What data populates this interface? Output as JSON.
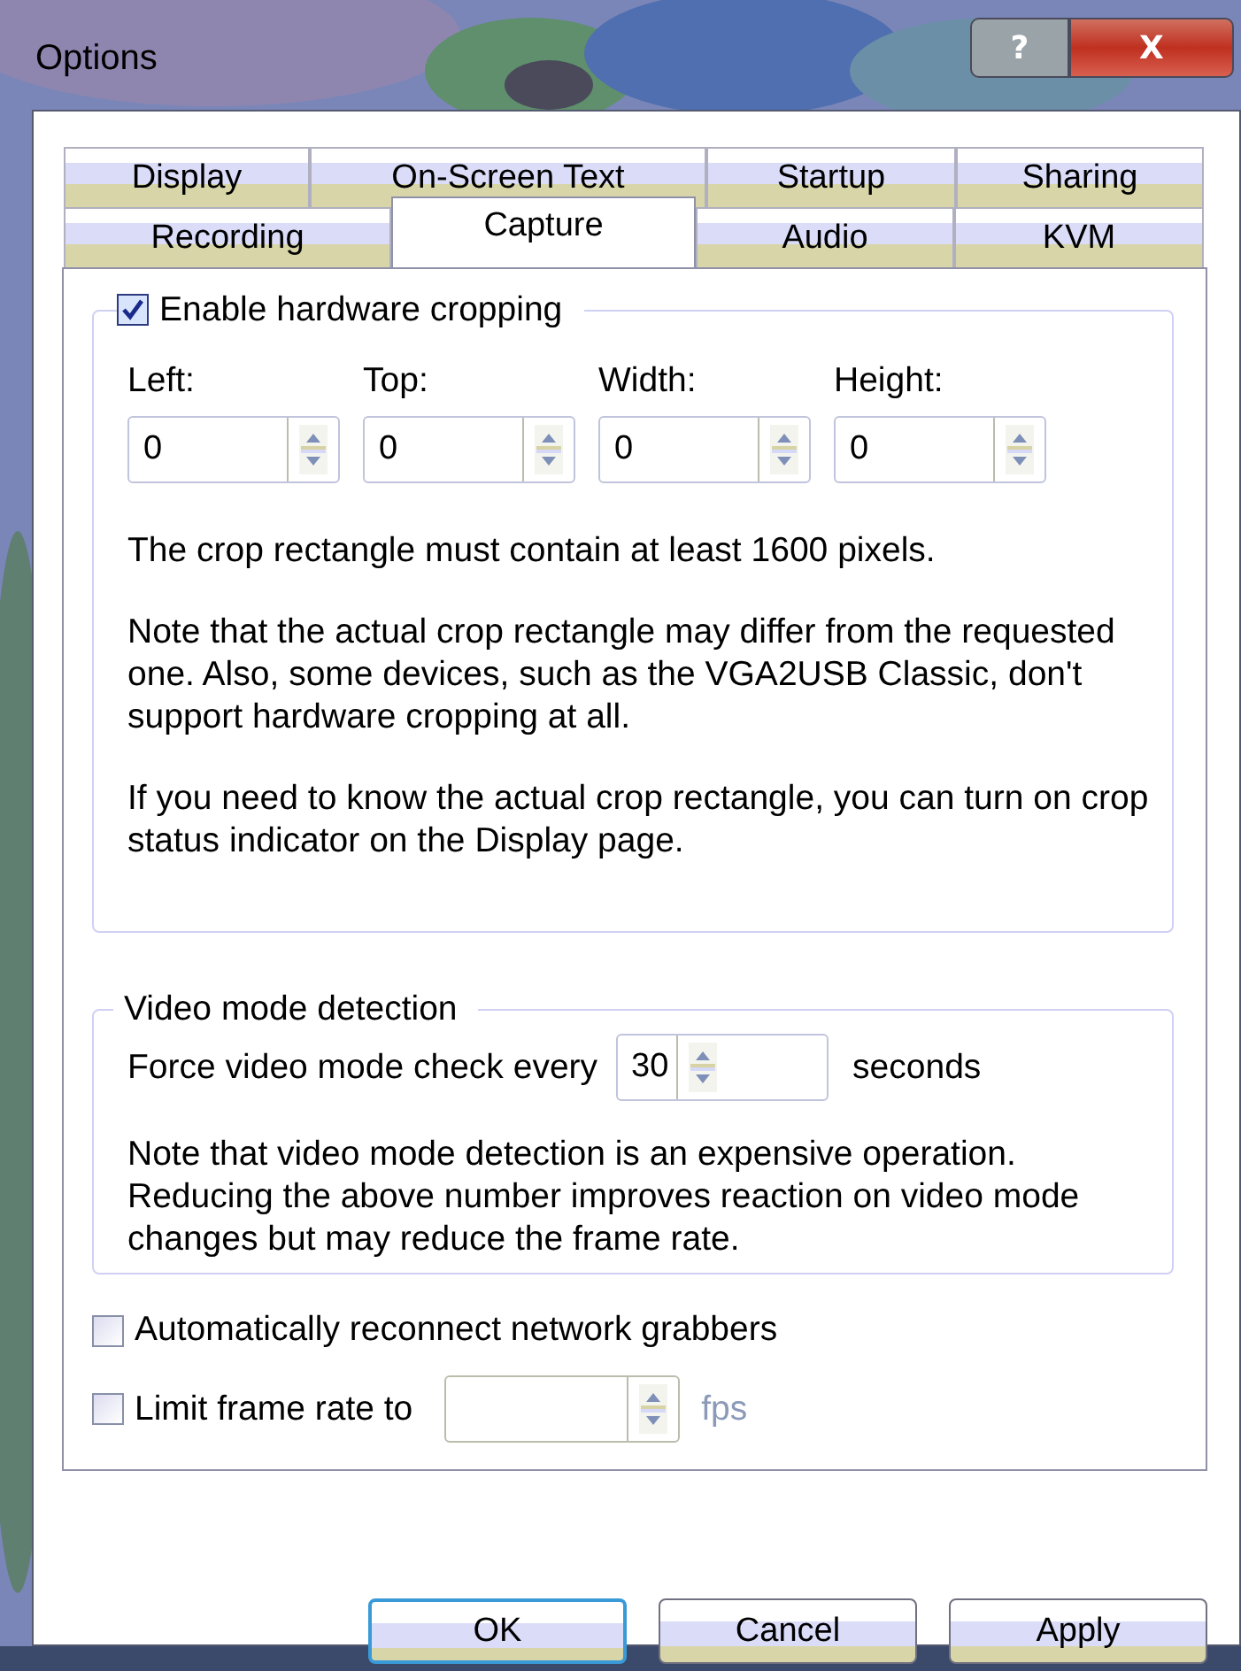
{
  "window": {
    "title": "Options",
    "buttons": [
      {
        "kind": "help",
        "label": "?"
      },
      {
        "kind": "close",
        "label": "X"
      }
    ]
  },
  "tab_rows": [
    [
      {
        "label": "Display",
        "selected": false
      },
      {
        "label": "On-Screen Text",
        "selected": false
      },
      {
        "label": "Startup",
        "selected": false
      },
      {
        "label": "Sharing",
        "selected": false
      }
    ],
    [
      {
        "label": "Recording",
        "selected": false
      },
      {
        "label": "Capture",
        "selected": true
      },
      {
        "label": "Audio",
        "selected": false
      },
      {
        "label": "KVM",
        "selected": false
      }
    ]
  ],
  "cropping": {
    "label": "Enable hardware cropping",
    "checked": true,
    "fields": [
      {
        "label": "Left:",
        "value": "0"
      },
      {
        "label": "Top:",
        "value": "0"
      },
      {
        "label": "Width:",
        "value": "0"
      },
      {
        "label": "Height:",
        "value": "0"
      }
    ],
    "notes": [
      "The crop rectangle must contain at least 1600 pixels.",
      "Note that the actual crop rectangle may differ from the requested one. Also, some devices, such as the VGA2USB Classic, don't support hardware cropping at all.",
      "If you need to know the actual crop rectangle, you can turn on crop status indicator on the Display page."
    ]
  },
  "video_mode": {
    "title": "Video mode detection",
    "prefix": "Force video mode check every",
    "value": "30",
    "suffix": "seconds",
    "note": "Note that video mode detection is an expensive operation. Reducing the above number improves reaction on video mode changes but may reduce the frame rate."
  },
  "reconnect": {
    "label": "Automatically reconnect network grabbers",
    "checked": false
  },
  "limit": {
    "label": "Limit frame rate to",
    "checked": false,
    "suffix": "fps"
  },
  "buttons": [
    {
      "label": "OK",
      "selected": true
    },
    {
      "label": "Cancel",
      "selected": false
    },
    {
      "label": "Apply",
      "selected": false
    }
  ]
}
